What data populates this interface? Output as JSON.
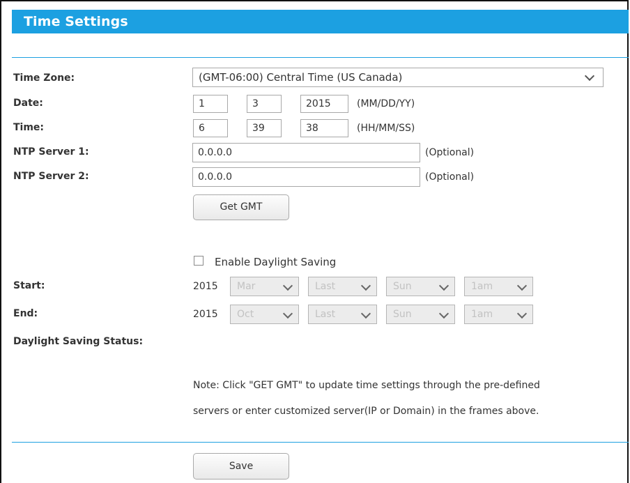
{
  "title": "Time Settings",
  "labels": {
    "time_zone": "Time Zone:",
    "date": "Date:",
    "time": "Time:",
    "ntp1": "NTP Server 1:",
    "ntp2": "NTP Server 2:",
    "start": "Start:",
    "end": "End:",
    "dst_status": "Daylight Saving Status:"
  },
  "time_zone": {
    "selected": "(GMT-06:00) Central Time (US Canada)"
  },
  "date": {
    "month": "1",
    "day": "3",
    "year": "2015",
    "format": "(MM/DD/YY)"
  },
  "time": {
    "hour": "6",
    "minute": "39",
    "second": "38",
    "format": "(HH/MM/SS)"
  },
  "ntp": {
    "server1": "0.0.0.0",
    "server2": "0.0.0.0",
    "optional": "(Optional)"
  },
  "buttons": {
    "get_gmt": "Get GMT",
    "save": "Save"
  },
  "daylight": {
    "enable_label": "Enable Daylight Saving",
    "enabled": false,
    "start": {
      "year": "2015",
      "month": "Mar",
      "week": "Last",
      "day": "Sun",
      "hour": "1am"
    },
    "end": {
      "year": "2015",
      "month": "Oct",
      "week": "Last",
      "day": "Sun",
      "hour": "1am"
    }
  },
  "note": {
    "line1": "Note: Click \"GET GMT\" to update time settings through the pre-defined",
    "line2": "servers or enter customized server(IP or Domain) in the frames above."
  },
  "colors": {
    "accent": "#1ca0e1"
  }
}
